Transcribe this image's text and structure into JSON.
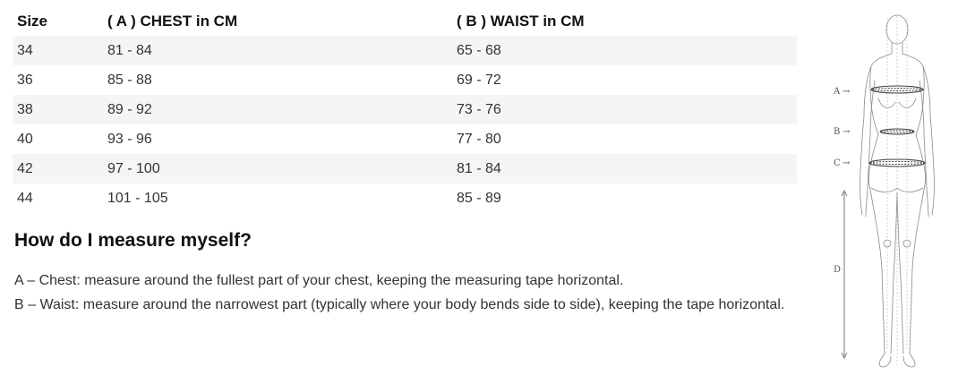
{
  "table": {
    "headers": [
      "Size",
      "( A ) CHEST in CM",
      "( B ) WAIST in CM"
    ],
    "rows": [
      {
        "size": "34",
        "chest": "81 - 84",
        "waist": "65 - 68"
      },
      {
        "size": "36",
        "chest": "85 - 88",
        "waist": "69 - 72"
      },
      {
        "size": "38",
        "chest": "89 - 92",
        "waist": "73 - 76"
      },
      {
        "size": "40",
        "chest": "93 - 96",
        "waist": "77 - 80"
      },
      {
        "size": "42",
        "chest": "97 - 100",
        "waist": "81 - 84"
      },
      {
        "size": "44",
        "chest": "101 - 105",
        "waist": "85 - 89"
      }
    ]
  },
  "guide": {
    "title": "How do I measure myself?",
    "chest_text": "A – Chest: measure around the fullest part of your chest, keeping the measuring tape horizontal.",
    "waist_text": "B – Waist: measure around the narrowest part (typically where your body bends side to side), keeping the tape horizontal."
  },
  "figure": {
    "labels": {
      "a": "A",
      "b": "B",
      "c": "C",
      "d": "D"
    },
    "arrow": "→"
  }
}
